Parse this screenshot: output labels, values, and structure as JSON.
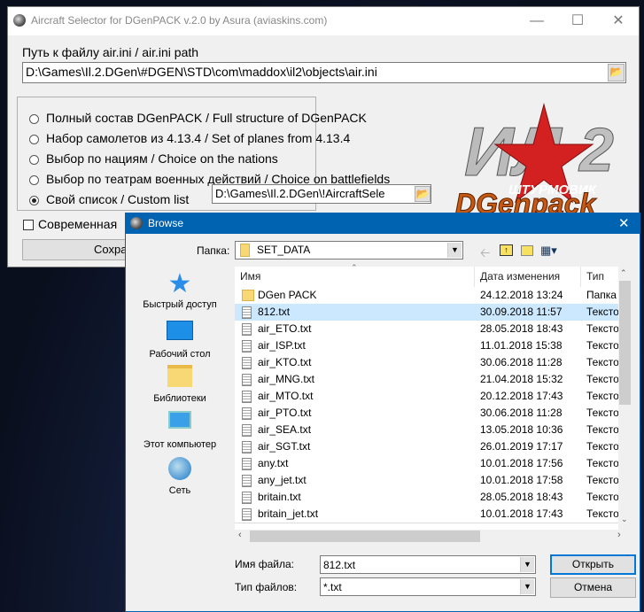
{
  "main": {
    "title": "Aircraft Selector for DGenPACK v.2.0 by Asura (aviaskins.com)",
    "path_label": "Путь к файлу air.ini / air.ini path",
    "path_value": "D:\\Games\\Il.2.DGen\\#DGEN\\STD\\com\\maddox\\il2\\objects\\air.ini",
    "options": [
      {
        "label": "Полный состав DGenPACK / Full structure of DGenPACK",
        "selected": false
      },
      {
        "label": "Набор самолетов из 4.13.4 / Set of planes from 4.13.4",
        "selected": false
      },
      {
        "label": "Выбор по нациям / Choice on the nations",
        "selected": false
      },
      {
        "label": "Выбор по театрам военных действий / Choice on battlefields",
        "selected": false
      },
      {
        "label": "Свой список / Custom list",
        "selected": true
      }
    ],
    "custom_list_value": "D:\\Games\\Il.2.DGen\\!AircraftSele",
    "checkbox_label": "Современная",
    "save_label": "Сохра",
    "logo_text": "ИЛ-2 ШТУРМОВИК DGenpack"
  },
  "dialog": {
    "title": "Browse",
    "folder_label": "Папка:",
    "folder_value": "SET_DATA",
    "nav": [
      "Быстрый доступ",
      "Рабочий стол",
      "Библиотеки",
      "Этот компьютер",
      "Сеть"
    ],
    "columns": [
      "Имя",
      "Дата изменения",
      "Тип"
    ],
    "rows": [
      {
        "name": "DGen PACK",
        "date": "24.12.2018 13:24",
        "type": "Папка",
        "folder": true
      },
      {
        "name": "812.txt",
        "date": "30.09.2018 11:57",
        "type": "Тексто",
        "selected": true
      },
      {
        "name": "air_ETO.txt",
        "date": "28.05.2018 18:43",
        "type": "Тексто"
      },
      {
        "name": "air_ISP.txt",
        "date": "11.01.2018 15:38",
        "type": "Тексто"
      },
      {
        "name": "air_KTO.txt",
        "date": "30.06.2018 11:28",
        "type": "Тексто"
      },
      {
        "name": "air_MNG.txt",
        "date": "21.04.2018 15:32",
        "type": "Тексто"
      },
      {
        "name": "air_MTO.txt",
        "date": "20.12.2018 17:43",
        "type": "Тексто"
      },
      {
        "name": "air_PTO.txt",
        "date": "30.06.2018 11:28",
        "type": "Тексто"
      },
      {
        "name": "air_SEA.txt",
        "date": "13.05.2018 10:36",
        "type": "Тексто"
      },
      {
        "name": "air_SGT.txt",
        "date": "26.01.2019 17:17",
        "type": "Тексто"
      },
      {
        "name": "any.txt",
        "date": "10.01.2018 17:56",
        "type": "Тексто"
      },
      {
        "name": "any_jet.txt",
        "date": "10.01.2018 17:58",
        "type": "Тексто"
      },
      {
        "name": "britain.txt",
        "date": "28.05.2018 18:43",
        "type": "Тексто"
      },
      {
        "name": "britain_jet.txt",
        "date": "10.01.2018 17:43",
        "type": "Тексто"
      }
    ],
    "filename_label": "Имя файла:",
    "filename_value": "812.txt",
    "filetype_label": "Тип файлов:",
    "filetype_value": "*.txt",
    "open_label": "Открыть",
    "cancel_label": "Отмена"
  }
}
